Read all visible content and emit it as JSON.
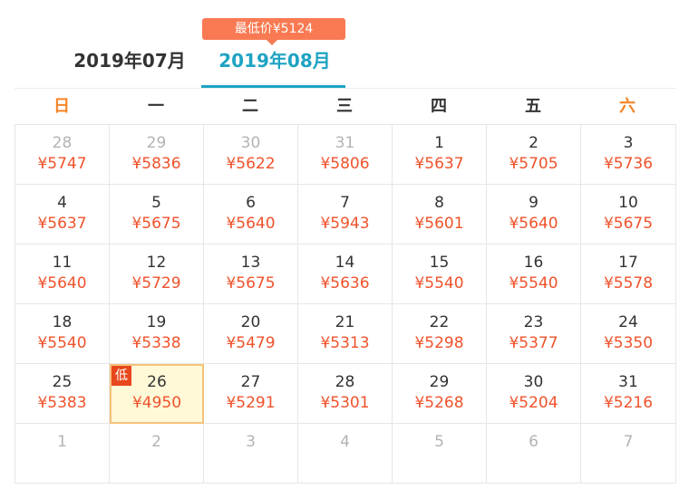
{
  "tabs": [
    {
      "label": "2019年07月"
    },
    {
      "label": "2019年08月"
    }
  ],
  "lowest_price_bubble": "最低价¥5124",
  "weekdays": [
    "日",
    "一",
    "二",
    "三",
    "四",
    "五",
    "六"
  ],
  "colors": {
    "accent": "#1ea3c2",
    "price": "#f0522b",
    "weekend": "#f78427",
    "badge": "#f97a52"
  },
  "calendar": [
    [
      {
        "day": "28",
        "price": "¥5747",
        "other": true
      },
      {
        "day": "29",
        "price": "¥5836",
        "other": true
      },
      {
        "day": "30",
        "price": "¥5622",
        "other": true
      },
      {
        "day": "31",
        "price": "¥5806",
        "other": true
      },
      {
        "day": "1",
        "price": "¥5637"
      },
      {
        "day": "2",
        "price": "¥5705"
      },
      {
        "day": "3",
        "price": "¥5736"
      }
    ],
    [
      {
        "day": "4",
        "price": "¥5637"
      },
      {
        "day": "5",
        "price": "¥5675"
      },
      {
        "day": "6",
        "price": "¥5640"
      },
      {
        "day": "7",
        "price": "¥5943"
      },
      {
        "day": "8",
        "price": "¥5601"
      },
      {
        "day": "9",
        "price": "¥5640"
      },
      {
        "day": "10",
        "price": "¥5675"
      }
    ],
    [
      {
        "day": "11",
        "price": "¥5640"
      },
      {
        "day": "12",
        "price": "¥5729"
      },
      {
        "day": "13",
        "price": "¥5675"
      },
      {
        "day": "14",
        "price": "¥5636"
      },
      {
        "day": "15",
        "price": "¥5540"
      },
      {
        "day": "16",
        "price": "¥5540"
      },
      {
        "day": "17",
        "price": "¥5578"
      }
    ],
    [
      {
        "day": "18",
        "price": "¥5540"
      },
      {
        "day": "19",
        "price": "¥5338"
      },
      {
        "day": "20",
        "price": "¥5479"
      },
      {
        "day": "21",
        "price": "¥5313"
      },
      {
        "day": "22",
        "price": "¥5298"
      },
      {
        "day": "23",
        "price": "¥5377"
      },
      {
        "day": "24",
        "price": "¥5350"
      }
    ],
    [
      {
        "day": "25",
        "price": "¥5383"
      },
      {
        "day": "26",
        "price": "¥4950",
        "lowest": true,
        "tag": "低"
      },
      {
        "day": "27",
        "price": "¥5291"
      },
      {
        "day": "28",
        "price": "¥5301"
      },
      {
        "day": "29",
        "price": "¥5268"
      },
      {
        "day": "30",
        "price": "¥5204"
      },
      {
        "day": "31",
        "price": "¥5216"
      }
    ],
    [
      {
        "day": "1",
        "price": "",
        "other": true
      },
      {
        "day": "2",
        "price": "",
        "other": true
      },
      {
        "day": "3",
        "price": "",
        "other": true
      },
      {
        "day": "4",
        "price": "",
        "other": true
      },
      {
        "day": "5",
        "price": "",
        "other": true
      },
      {
        "day": "6",
        "price": "",
        "other": true
      },
      {
        "day": "7",
        "price": "",
        "other": true
      }
    ]
  ]
}
